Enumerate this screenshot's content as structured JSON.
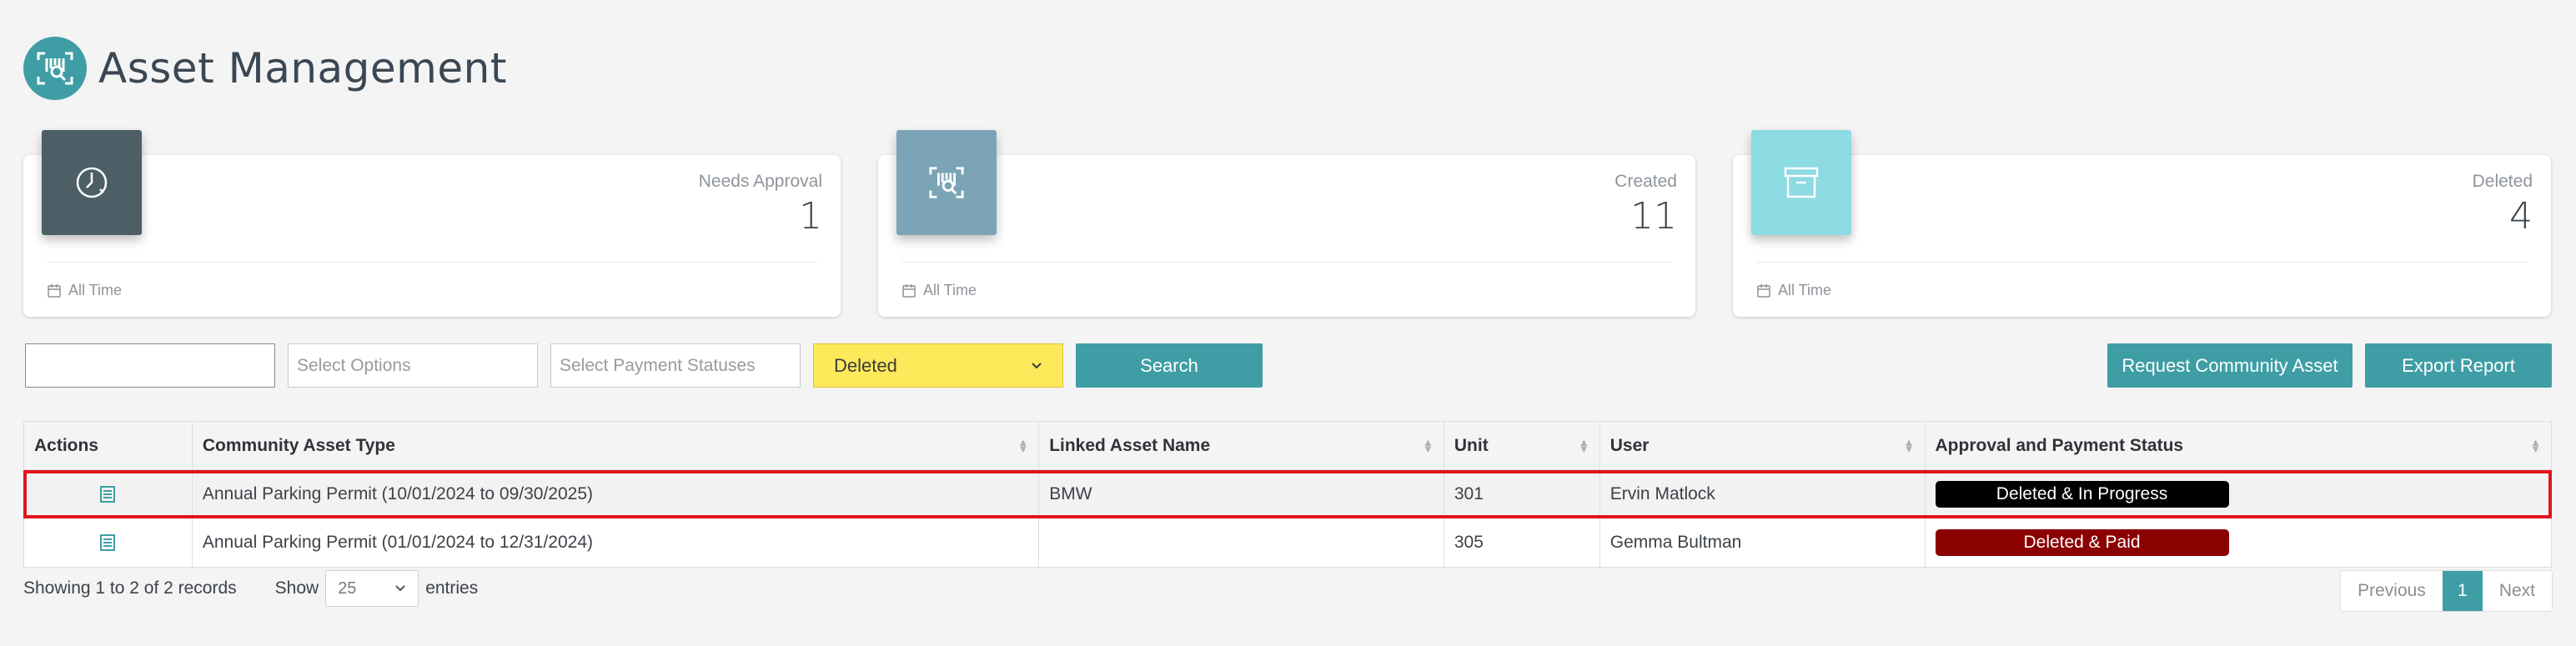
{
  "header": {
    "title": "Asset Management",
    "logo_icon": "asset-scan-icon"
  },
  "colors": {
    "accent": "#3f9ea5",
    "status_filter": "#fde95a",
    "badge_in_progress": "#000000",
    "badge_paid": "#8b0000",
    "highlight": "#e0141e"
  },
  "cards": [
    {
      "label": "Needs Approval",
      "value": "1",
      "footer": "All Time",
      "icon": "clock-icon",
      "color": "#4d5f66"
    },
    {
      "label": "Created",
      "value": "11",
      "footer": "All Time",
      "icon": "asset-scan-icon",
      "color": "#7ba5b6"
    },
    {
      "label": "Deleted",
      "value": "4",
      "footer": "All Time",
      "icon": "archive-box-icon",
      "color": "#8cdbe3"
    }
  ],
  "filters": {
    "search_value": "",
    "options_placeholder": "Select Options",
    "payment_placeholder": "Select Payment Statuses",
    "status_value": "Deleted",
    "search_button": "Search",
    "request_button": "Request Community Asset",
    "export_button": "Export Report"
  },
  "table": {
    "columns": [
      "Actions",
      "Community Asset Type",
      "Linked Asset Name",
      "Unit",
      "User",
      "Approval and Payment Status"
    ],
    "rows": [
      {
        "type": "Annual Parking Permit (10/01/2024 to 09/30/2025)",
        "linked": "BMW",
        "unit": "301",
        "user": "Ervin Matlock",
        "status": "Deleted & In Progress"
      },
      {
        "type": "Annual Parking Permit (01/01/2024 to 12/31/2024)",
        "linked": "",
        "unit": "305",
        "user": "Gemma Bultman",
        "status": "Deleted & Paid"
      }
    ]
  },
  "footer": {
    "showing": "Showing 1 to 2 of 2 records",
    "show_label": "Show",
    "show_value": "25",
    "entries_label": "entries",
    "previous": "Previous",
    "current_page": "1",
    "next": "Next"
  }
}
